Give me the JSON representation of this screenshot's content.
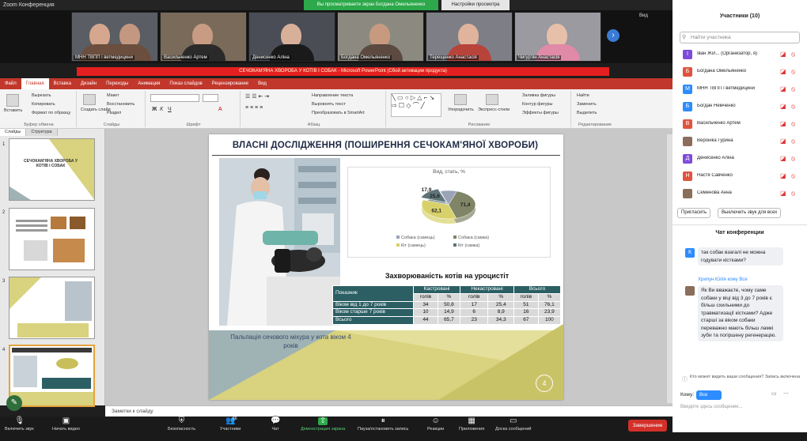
{
  "zoom": {
    "window_title": "Zoom Конференция",
    "share_banner": "Вы просматриваете экран Богдана Омельяненко",
    "view_settings": "Настройки просмотра",
    "view_label": "Вид",
    "videos": [
      {
        "name": "МНН ТВПП і ветмедицини"
      },
      {
        "name": "Васильченко Артем"
      },
      {
        "name": "Денисенко Аліна"
      },
      {
        "name": "Богдана Омельяненко"
      },
      {
        "name": "Терещенко Анастасія"
      },
      {
        "name": "Чигур'ян Анастасія"
      }
    ]
  },
  "ppt": {
    "window_title": "СЕЧОКАМ'ЯНА ХВОРОБА У КОТІВ І СОБАК - Microsoft PowerPoint (Сбой активации продукта)",
    "tabs": [
      "Файл",
      "Главная",
      "Вставка",
      "Дизайн",
      "Переходы",
      "Анимация",
      "Показ слайдов",
      "Рецензирование",
      "Вид"
    ],
    "active_tab": "Главная",
    "ribbon": {
      "insert": "Вставить",
      "cut": "Вырезать",
      "copy": "Копировать",
      "format_painter": "Формат по образцу",
      "clipboard": "Буфер обмена",
      "new_slide": "Создать слайд",
      "layout": "Макет",
      "reset": "Восстановить",
      "section": "Раздел",
      "slides": "Слайды",
      "font": "Шрифт",
      "text_direction": "Направление текста",
      "align_text": "Выровнять текст",
      "smartart": "Преобразовать в SmartArt",
      "paragraph": "Абзац",
      "arrange": "Упорядочить",
      "quick_styles": "Экспресс-стили",
      "drawing": "Рисование",
      "shape_fill": "Заливка фигуры",
      "shape_outline": "Контур фигуры",
      "shape_effects": "Эффекты фигуры",
      "find": "Найти",
      "replace": "Заменить",
      "select": "Выделить",
      "editing": "Редактирование"
    },
    "pane_tabs": [
      "Слайды",
      "Структура"
    ],
    "thumbs": [
      {
        "num": "1",
        "title": "СЕЧОКАМ'ЯНА ХВОРОБА У КОТІВ І СОБАК"
      },
      {
        "num": "2",
        "title": ""
      },
      {
        "num": "3",
        "title": ""
      },
      {
        "num": "4",
        "title": ""
      }
    ],
    "notes_placeholder": "Заметки к слайду"
  },
  "slide": {
    "title": "ВЛАСНІ ДОСЛІДЖЕННЯ (ПОШИРЕННЯ СЕЧОКАМ'ЯНОЇ ХВОРОБИ)",
    "caption": "Пальпація сечового міхура у кота віком 4 років",
    "number": "4",
    "table_title": "Захворюваність котів на уроцистіт",
    "table": {
      "header1": [
        "Показник",
        "Кастровані",
        "Некастровані",
        "Всього"
      ],
      "header2": [
        "голів",
        "%",
        "голів",
        "%",
        "голів",
        "%"
      ],
      "rows": [
        {
          "label": "Віком від 1 до 7 років",
          "values": [
            "34",
            "50,8",
            "17",
            "25,4",
            "51",
            "76,1"
          ]
        },
        {
          "label": "Віком старше 7 років",
          "values": [
            "10",
            "14,9",
            "6",
            "8,9",
            "16",
            "23,9"
          ]
        },
        {
          "label": "Всього",
          "values": [
            "44",
            "65,7",
            "23",
            "34,3",
            "67",
            "100"
          ]
        }
      ]
    }
  },
  "chart_data": {
    "type": "pie",
    "title": "Вид, стать, %",
    "categories": [
      "Собака (самець)",
      "Собака (самка)",
      "Кіт (самець)",
      "Кіт (самка)"
    ],
    "values": [
      17.9,
      71.4,
      62.1,
      25.6
    ],
    "value_labels": [
      "17,9",
      "71,4",
      "62,1",
      "25,6"
    ],
    "colors": [
      "#9aa3b8",
      "#7f8566",
      "#d8d16b",
      "#5e7478"
    ],
    "legend_position": "bottom"
  },
  "toolbar": {
    "items": [
      {
        "icon": "mic-muted-icon",
        "label": "Включить звук"
      },
      {
        "icon": "video-off-icon",
        "label": "Начать видео"
      },
      {
        "icon": "security-icon",
        "label": "Безопасность"
      },
      {
        "icon": "participants-icon",
        "label": "Участники"
      },
      {
        "icon": "chat-icon",
        "label": "Чат"
      },
      {
        "icon": "share-screen-icon",
        "label": "Демонстрация экрана"
      },
      {
        "icon": "record-icon",
        "label": "Пауза/остановить запись"
      },
      {
        "icon": "reactions-icon",
        "label": "Реакции"
      },
      {
        "icon": "apps-icon",
        "label": "Приложения"
      },
      {
        "icon": "captions-icon",
        "label": "Доска сообщений"
      }
    ],
    "participants_count": "66",
    "end_label": "Завершение"
  },
  "panel": {
    "participants_header": "Участники (10)",
    "search_placeholder": "Найти участника",
    "participants": [
      {
        "initial": "І",
        "color": "#7d4cdb",
        "name": "Іван Жіл... (Организатор, я)"
      },
      {
        "initial": "Б",
        "color": "#e0533d",
        "name": "Богдана Омельяненко"
      },
      {
        "initial": "М",
        "color": "#2d8cff",
        "name": "МНН ТВПП і ветмедицини"
      },
      {
        "initial": "Б",
        "color": "#2d8cff",
        "name": "Богдан Немченко"
      },
      {
        "initial": "В",
        "color": "#e0533d",
        "name": "Васильченко Артем"
      },
      {
        "initial": "",
        "color": "#8a6d5b",
        "name": "Вероніка Гурина"
      },
      {
        "initial": "Д",
        "color": "#7d4cdb",
        "name": "Денисенко Аліна"
      },
      {
        "initial": "Н",
        "color": "#e0533d",
        "name": "Настя Савченко"
      },
      {
        "initial": "",
        "color": "#8a6d5b",
        "name": "Семенова Анна"
      }
    ],
    "invite": "Пригласить",
    "mute_all": "Выключить звук для всех",
    "chat_header": "Чат конференции",
    "message1": "так собак взагалі не можна годувати кістками?",
    "message2_author": "Хрипун Юлія кому Все",
    "message2": "Як Ви вважаєте, чому саме собаки у віці від 3 до 7 років є більш схильними до травматизації кістками? Адже старші за віком собаки переважно мають більш ламкі зуби та погіршену регенерацію.",
    "who_sees": "Кто может видеть ваши сообщения? Запись включена",
    "to_label": "Кому:",
    "to_value": "Все",
    "chat_placeholder": "Введите здесь сообщение..."
  }
}
